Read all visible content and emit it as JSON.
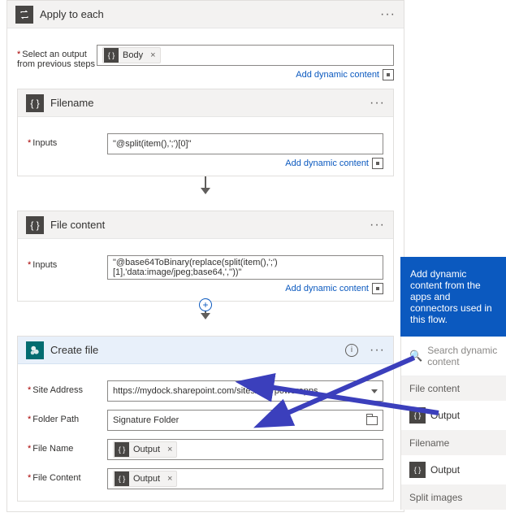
{
  "outer": {
    "title": "Apply to each",
    "selectOutputLabel": "Select an output from previous steps",
    "bodyToken": "Body",
    "addDynamic": "Add dynamic content"
  },
  "filename": {
    "title": "Filename",
    "inputsLabel": "Inputs",
    "value": "\"@split(item(),';')[0]\"",
    "addDynamic": "Add dynamic content"
  },
  "filecontent": {
    "title": "File content",
    "inputsLabel": "Inputs",
    "value": "\"@base64ToBinary(replace(split(item(),';')[1],'data:image/jpeg;base64,',''))\"",
    "addDynamic": "Add dynamic content"
  },
  "createfile": {
    "title": "Create file",
    "siteAddressLabel": "Site Address",
    "siteAddressValue": "https://mydock.sharepoint.com/sites/dev/powerapps",
    "folderPathLabel": "Folder Path",
    "folderPathValue": "Signature Folder",
    "fileNameLabel": "File Name",
    "fileNameToken": "Output",
    "fileContentLabel": "File Content",
    "fileContentToken": "Output"
  },
  "panel": {
    "headerText": "Add dynamic content from the apps and connectors used in this flow.",
    "searchPlaceholder": "Search dynamic content",
    "sectionFileContent": "File content",
    "sectionFilename": "Filename",
    "sectionSplit": "Split images",
    "outputLabel": "Output"
  }
}
